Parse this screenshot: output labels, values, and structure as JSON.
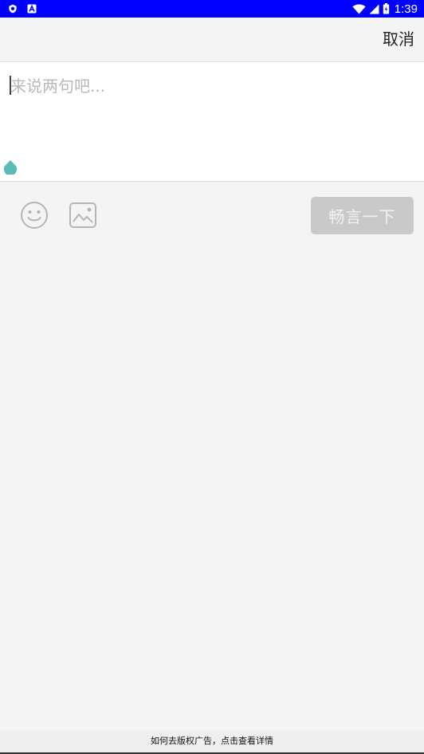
{
  "status_bar": {
    "time": "1:39",
    "left_icons": [
      "shield-icon",
      "a-icon"
    ],
    "right_icons": [
      "wifi-icon",
      "signal-icon",
      "battery-icon"
    ],
    "background": "#0000ff"
  },
  "top_bar": {
    "cancel_label": "取消"
  },
  "editor": {
    "placeholder": "来说两句吧...",
    "value": "",
    "caret_handle_color": "#5bbcb6"
  },
  "toolbar": {
    "emoji_icon": "smiley-icon",
    "image_icon": "image-icon",
    "send_label": "畅言一下",
    "send_button_color": "#c9c9c9"
  },
  "ad": {
    "text": "如何去版权广告，点击查看详情"
  }
}
